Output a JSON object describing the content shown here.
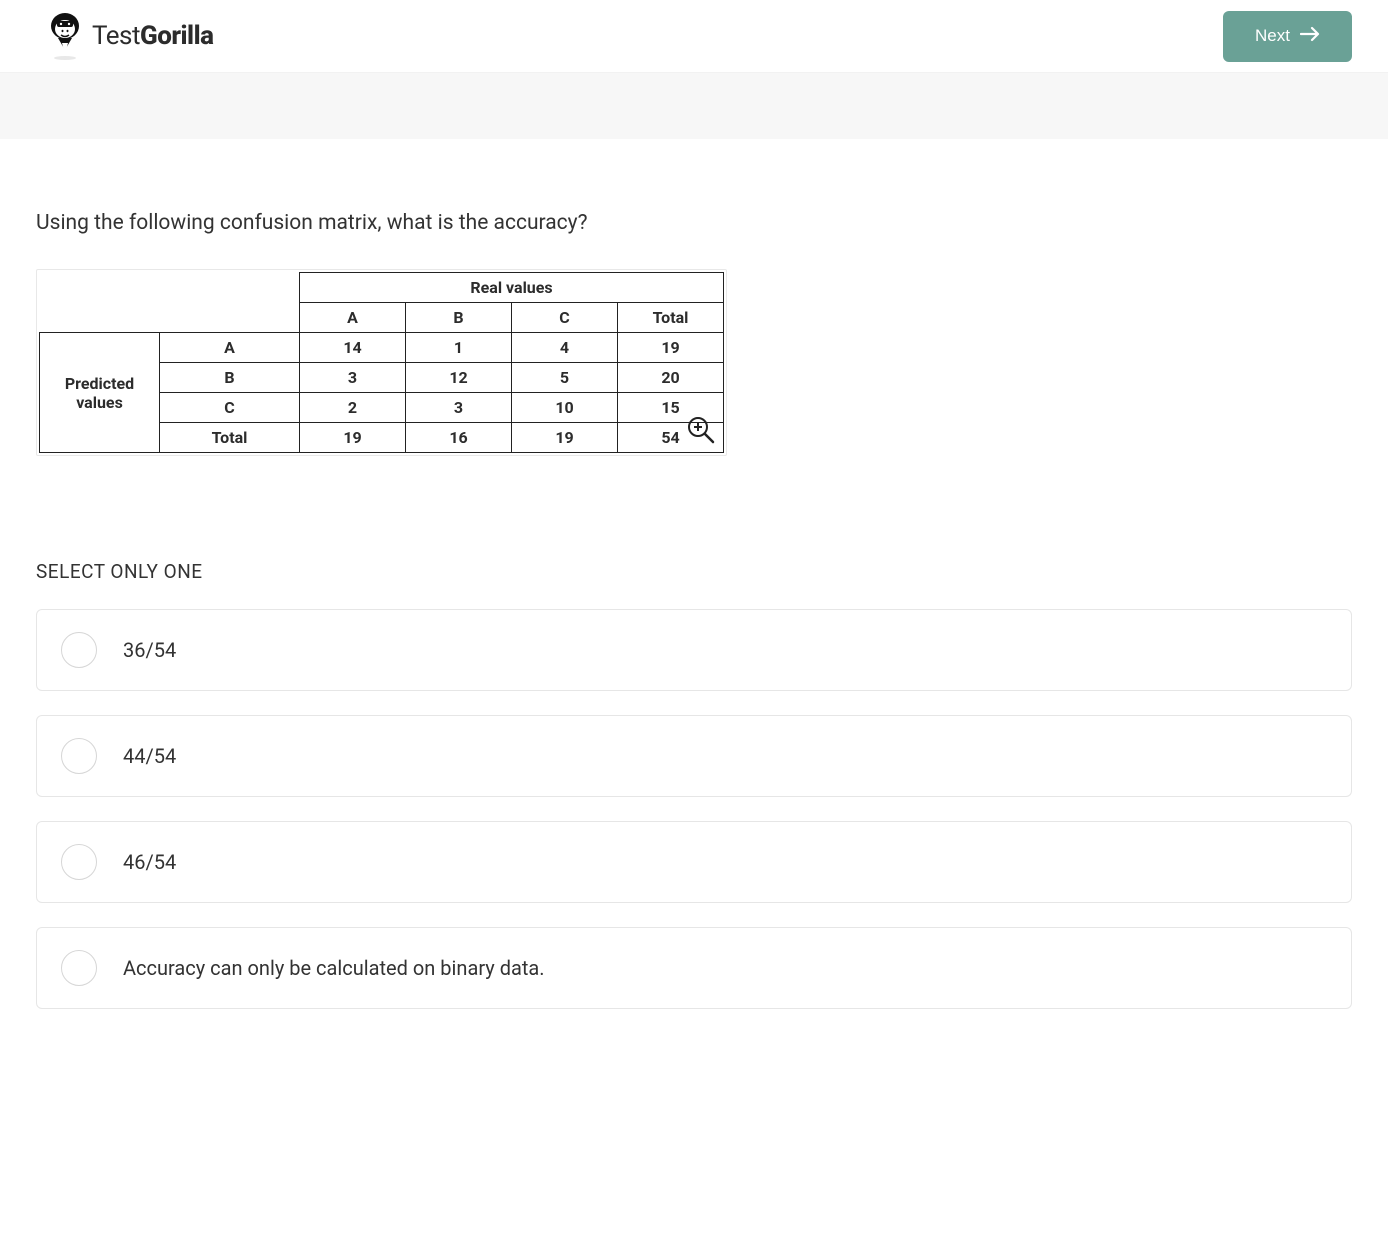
{
  "header": {
    "logo_light": "Test",
    "logo_bold": "Gorilla",
    "next_label": "Next"
  },
  "question": "Using the following confusion matrix, what is the accuracy?",
  "matrix": {
    "real_values_header": "Real values",
    "predicted_values_header": "Predicted values",
    "col_headers": [
      "A",
      "B",
      "C",
      "Total"
    ],
    "row_headers": [
      "A",
      "B",
      "C",
      "Total"
    ],
    "rows": [
      [
        "14",
        "1",
        "4",
        "19"
      ],
      [
        "3",
        "12",
        "5",
        "20"
      ],
      [
        "2",
        "3",
        "10",
        "15"
      ],
      [
        "19",
        "16",
        "19",
        "54"
      ]
    ]
  },
  "select_label": "SELECT ONLY ONE",
  "options": [
    "36/54",
    "44/54",
    "46/54",
    "Accuracy can only be calculated on binary data."
  ]
}
